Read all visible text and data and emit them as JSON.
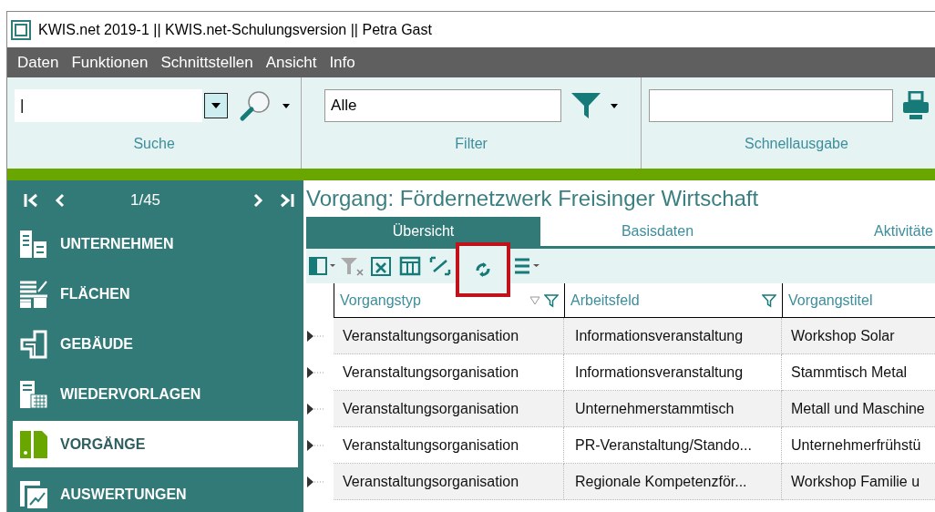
{
  "window": {
    "title": "KWIS.net 2019-1 || KWIS.net-Schulungsversion || Petra Gast"
  },
  "menu": [
    "Daten",
    "Funktionen",
    "Schnittstellen",
    "Ansicht",
    "Info"
  ],
  "ribbon": {
    "search": {
      "value": "|",
      "label": "Suche"
    },
    "filter": {
      "value": "Alle",
      "label": "Filter"
    },
    "output": {
      "label": "Schnellausgabe"
    }
  },
  "navigator": {
    "position": "1/45"
  },
  "sidebar": {
    "items": [
      {
        "label": "UNTERNEHMEN",
        "kind": "company",
        "selected": false
      },
      {
        "label": "FLÄCHEN",
        "kind": "areas",
        "selected": false
      },
      {
        "label": "GEBÄUDE",
        "kind": "building",
        "selected": false
      },
      {
        "label": "WIEDERVORLAGEN",
        "kind": "calendar",
        "selected": false
      },
      {
        "label": "VORGÄNGE",
        "kind": "folder",
        "selected": true
      },
      {
        "label": "AUSWERTUNGEN",
        "kind": "chart",
        "selected": false
      }
    ]
  },
  "heading": "Vorgang: Fördernetzwerk Freisinger Wirtschaft",
  "tabs": [
    {
      "label": "Übersicht",
      "selected": true
    },
    {
      "label": "Basisdaten",
      "selected": false
    },
    {
      "label": "Aktivitäte",
      "selected": false
    }
  ],
  "toolbar": [
    {
      "kind": "columns",
      "highlighted": false
    },
    {
      "kind": "clear-filter",
      "highlighted": false
    },
    {
      "kind": "excel",
      "highlighted": false
    },
    {
      "kind": "layout",
      "highlighted": false
    },
    {
      "kind": "fit",
      "highlighted": false
    },
    {
      "kind": "refresh",
      "highlighted": true
    },
    {
      "kind": "list",
      "highlighted": false
    }
  ],
  "table": {
    "columns": [
      "Vorgangstyp",
      "Arbeitsfeld",
      "Vorgangstitel"
    ],
    "rows": [
      [
        "Veranstaltungsorganisation",
        "Informationsveranstaltung",
        "Workshop Solar"
      ],
      [
        "Veranstaltungsorganisation",
        "Informationsveranstaltung",
        "Stammtisch Metal"
      ],
      [
        "Veranstaltungsorganisation",
        "Unternehmerstammtisch",
        "Metall und Maschine"
      ],
      [
        "Veranstaltungsorganisation",
        "PR-Veranstaltung/Stando...",
        "Unternehmerfrühstü"
      ],
      [
        "Veranstaltungsorganisation",
        "Regionale  Kompetenzför...",
        "Workshop Familie u"
      ]
    ]
  }
}
